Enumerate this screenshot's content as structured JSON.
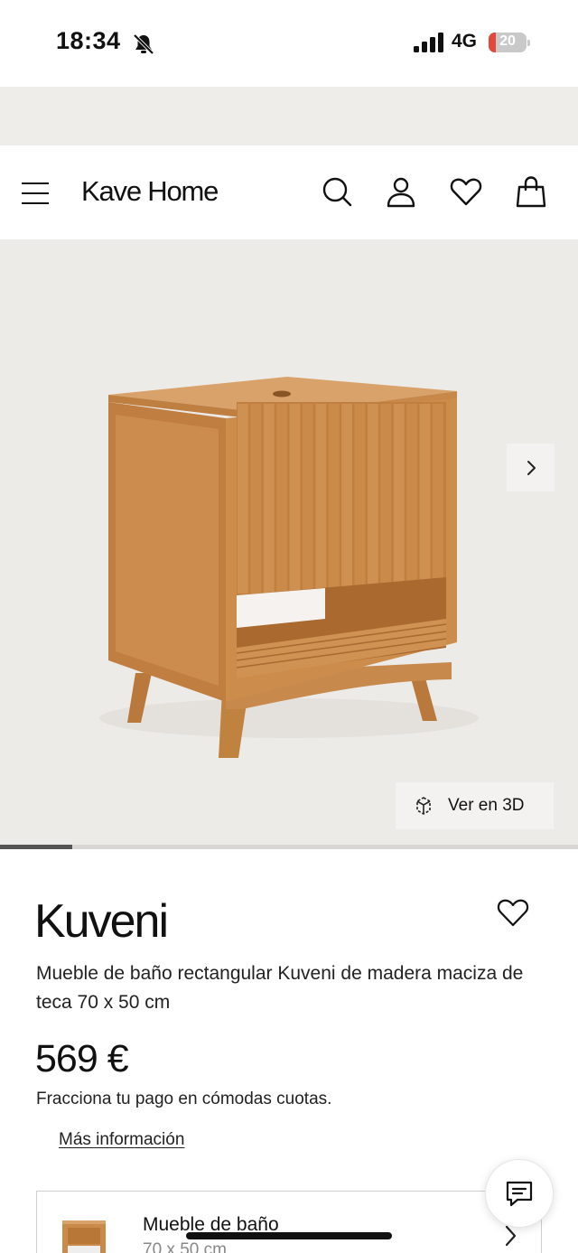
{
  "status_bar": {
    "time": "18:34",
    "network": "4G",
    "battery_level": "20",
    "battery_fraction": 0.2,
    "battery_color": "#e5463c"
  },
  "header": {
    "logo": "Kave Home",
    "icons": [
      "menu-icon",
      "search-icon",
      "account-icon",
      "heart-icon",
      "bag-icon"
    ]
  },
  "gallery": {
    "view_3d_label": "Ver en 3D",
    "slide_progress": 0.125
  },
  "product": {
    "name": "Kuveni",
    "description": "Mueble de baño rectangular Kuveni de madera maciza de teca 70 x 50 cm",
    "price": "569 €",
    "installments_text": "Fracciona tu pago en cómodas cuotas.",
    "more_info_link": "Más información"
  },
  "variant": {
    "name": "Mueble de baño",
    "dimensions": "70 x 50 cm"
  },
  "colors": {
    "background_beige": "#efedea",
    "gallery_bg": "#edebe8",
    "wood": "#c98a4a",
    "text": "#111111"
  }
}
